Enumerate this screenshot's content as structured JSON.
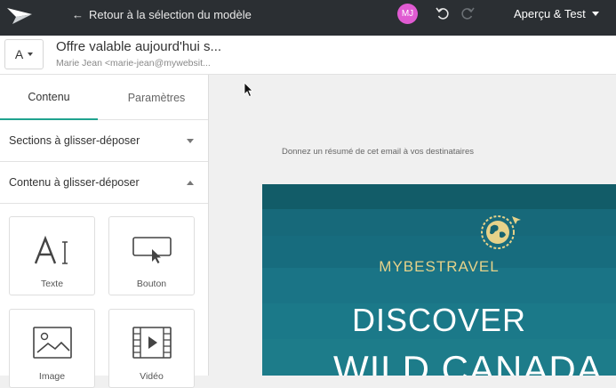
{
  "topbar": {
    "back_label": "Retour à la sélection du modèle",
    "avatar_initials": "MJ",
    "preview_label": "Aperçu & Test"
  },
  "subheader": {
    "sender_letter": "A",
    "subject": "Offre valable aujourd'hui s...",
    "from": "Marie Jean <marie-jean@mywebsit..."
  },
  "sidebar": {
    "tabs": [
      {
        "label": "Contenu"
      },
      {
        "label": "Paramètres"
      }
    ],
    "sections": [
      {
        "label": "Sections à glisser-déposer"
      },
      {
        "label": "Contenu à glisser-déposer"
      }
    ],
    "blocks": [
      {
        "label": "Texte",
        "icon": "text-icon"
      },
      {
        "label": "Bouton",
        "icon": "button-icon"
      },
      {
        "label": "Image",
        "icon": "image-icon"
      },
      {
        "label": "Vidéo",
        "icon": "video-icon"
      }
    ]
  },
  "canvas": {
    "preheader": "Donnez un résumé de cet email à vos destinataires",
    "brand": "MYBESTRAVEL",
    "hero_line1": "DISCOVER",
    "hero_line2": "WILD CANADA"
  },
  "colors": {
    "topbar": "#2b2f33",
    "accent_tab": "#20a38f",
    "avatar": "#e05bd2",
    "hero": "#16636f",
    "brand_gold": "#e6d28a"
  }
}
